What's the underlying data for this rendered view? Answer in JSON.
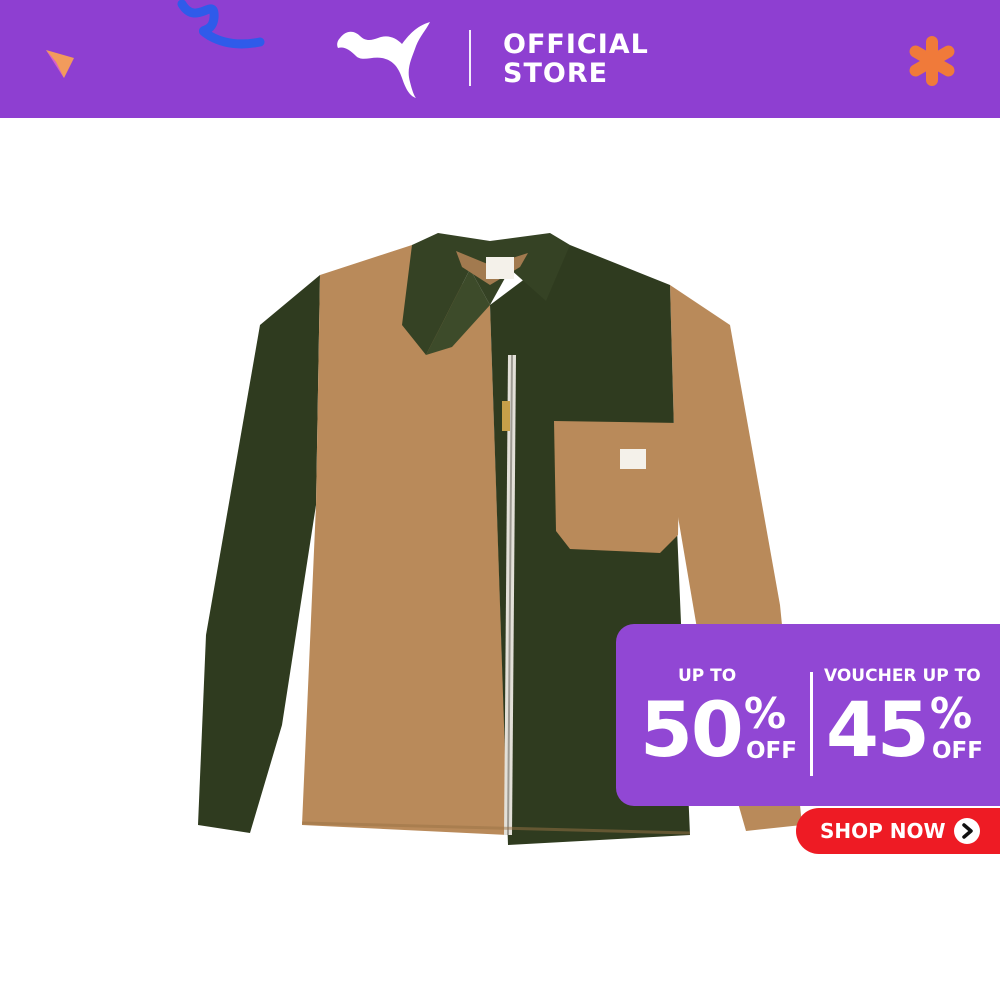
{
  "header": {
    "store_line1": "OFFICIAL",
    "store_line2": "STORE",
    "background": "#8e3fd1"
  },
  "promo": {
    "left": {
      "label": "UP TO",
      "number": "50",
      "percent": "%",
      "suffix": "OFF"
    },
    "right": {
      "label": "VOUCHER UP TO",
      "number": "45",
      "percent": "%",
      "suffix": "OFF"
    },
    "background": "#9147d4"
  },
  "cta": {
    "label": "SHOP NOW",
    "icon": "chevron-right-icon",
    "color": "#ee1b24"
  },
  "product": {
    "icon": "jacket-image",
    "colors": {
      "tan": "#b98a5a",
      "olive": "#2f3b1f"
    }
  }
}
